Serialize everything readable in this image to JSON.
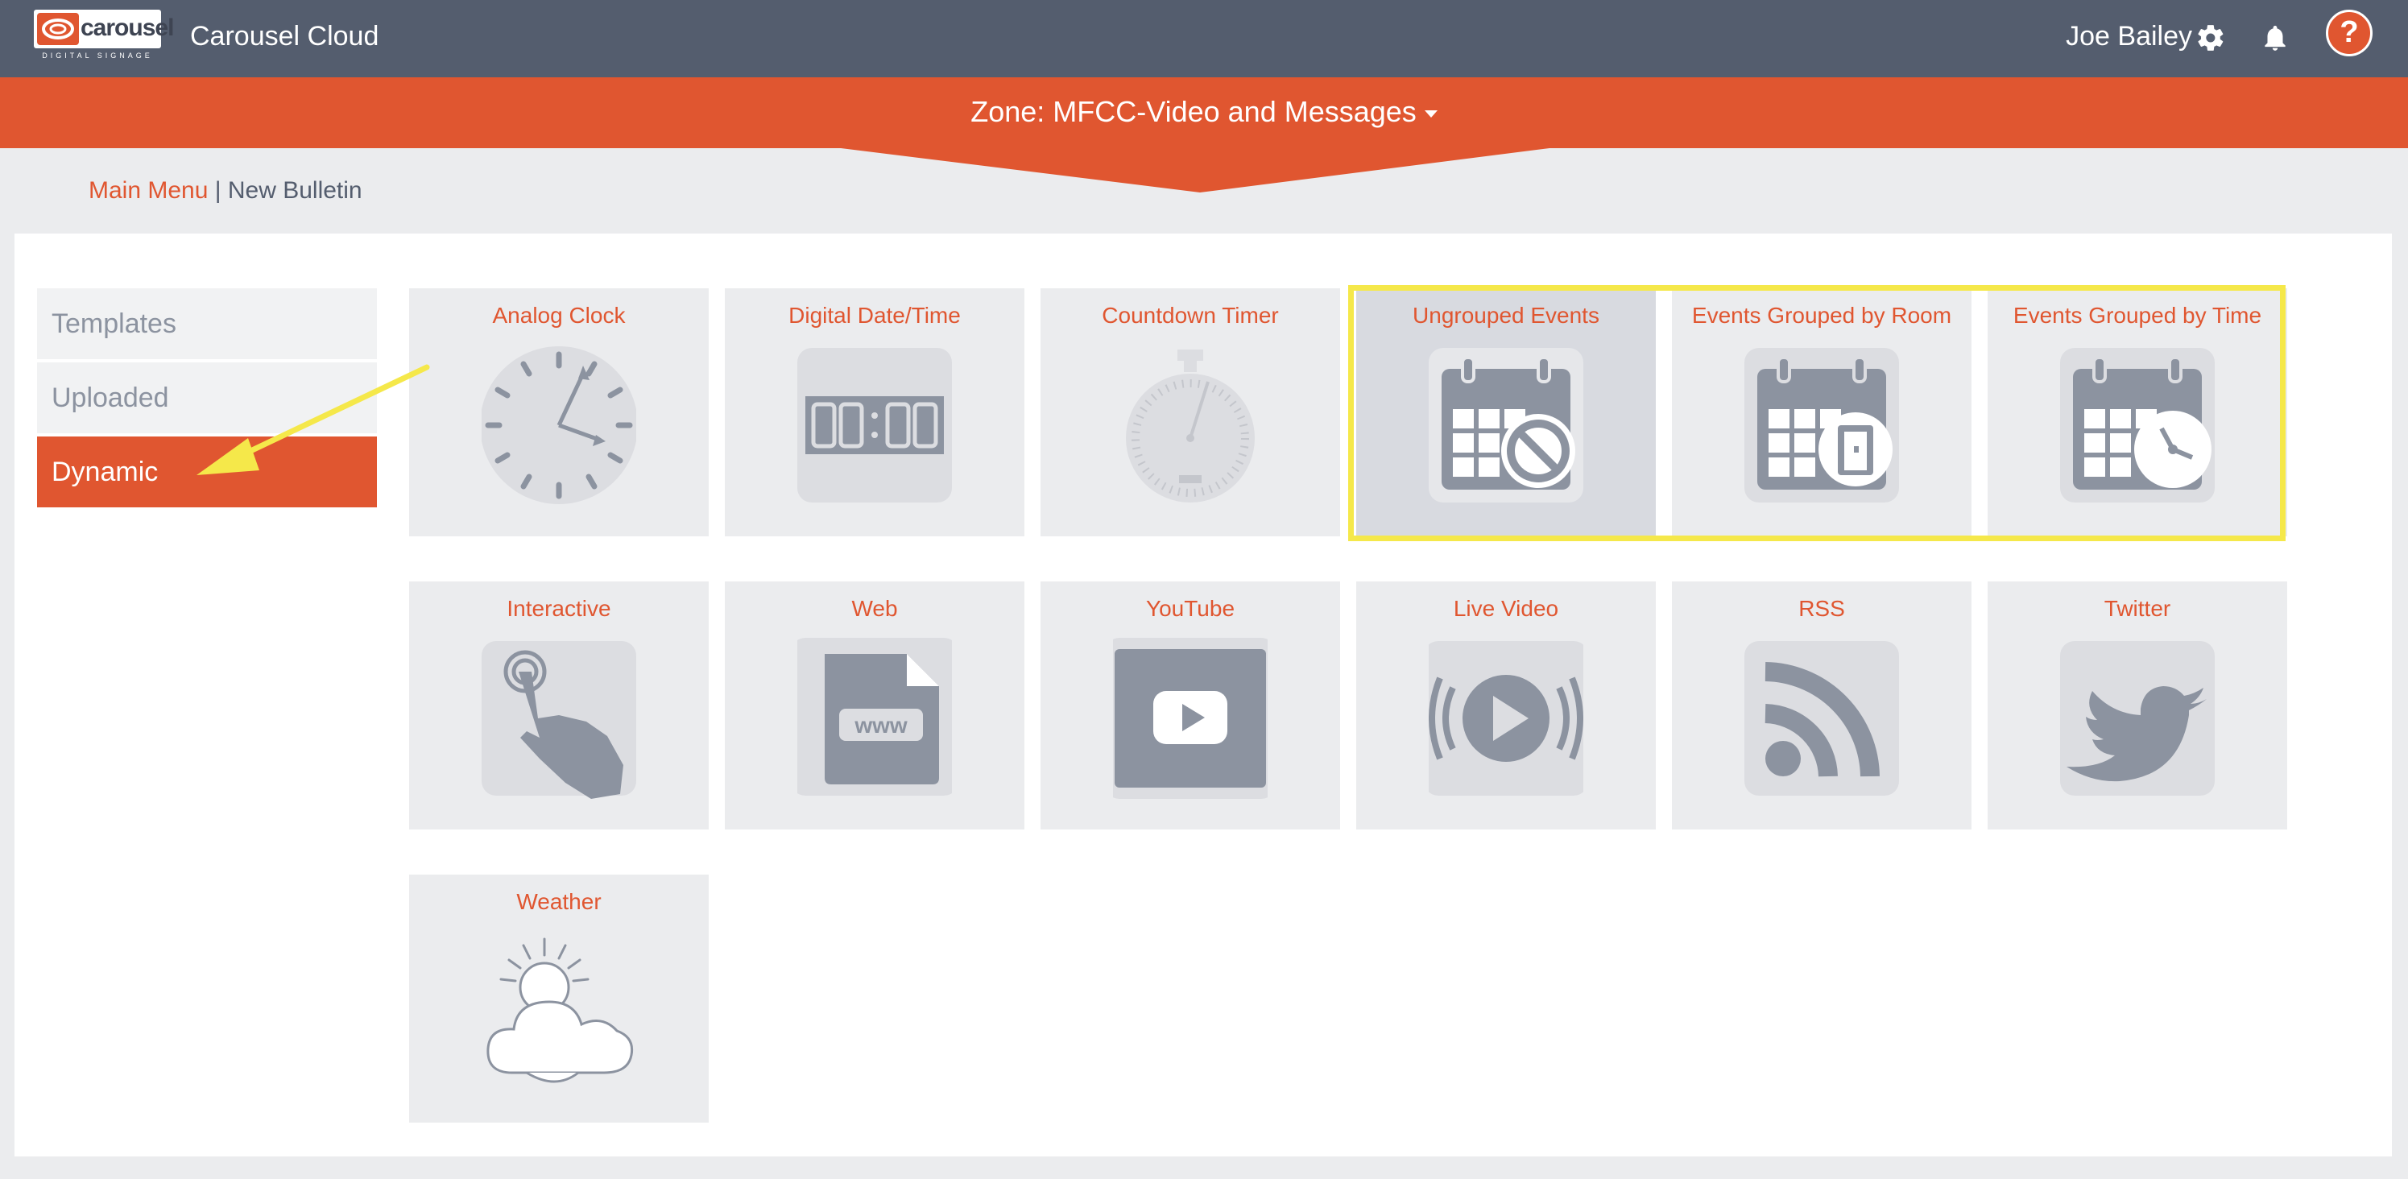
{
  "header": {
    "logo_word": "carousel",
    "logo_sub": "DIGITAL SIGNAGE",
    "app_title": "Carousel Cloud",
    "user_name": "Joe Bailey",
    "help_label": "?"
  },
  "zone": {
    "label": "Zone: MFCC-Video and Messages"
  },
  "breadcrumb": {
    "main": "Main Menu",
    "separator": " | ",
    "current": "New Bulletin"
  },
  "sidebar": {
    "items": [
      {
        "label": "Templates",
        "active": false
      },
      {
        "label": "Uploaded",
        "active": false
      },
      {
        "label": "Dynamic",
        "active": true
      }
    ]
  },
  "tiles": [
    {
      "label": "Analog Clock",
      "icon": "analog-clock-icon"
    },
    {
      "label": "Digital Date/Time",
      "icon": "digital-time-icon"
    },
    {
      "label": "Countdown Timer",
      "icon": "stopwatch-icon"
    },
    {
      "label": "Ungrouped Events",
      "icon": "calendar-no-icon"
    },
    {
      "label": "Events Grouped by Room",
      "icon": "calendar-door-icon"
    },
    {
      "label": "Events Grouped by Time",
      "icon": "calendar-clock-icon"
    },
    {
      "label": "Interactive",
      "icon": "touch-hand-icon"
    },
    {
      "label": "Web",
      "icon": "web-file-icon"
    },
    {
      "label": "YouTube",
      "icon": "youtube-icon"
    },
    {
      "label": "Live Video",
      "icon": "live-video-icon"
    },
    {
      "label": "RSS",
      "icon": "rss-icon"
    },
    {
      "label": "Twitter",
      "icon": "twitter-icon"
    },
    {
      "label": "Weather",
      "icon": "weather-icon"
    }
  ],
  "colors": {
    "accent": "#e05630",
    "topbar": "#545d6e",
    "icon_gray": "#8c93a0",
    "highlight": "#f5e84a"
  }
}
